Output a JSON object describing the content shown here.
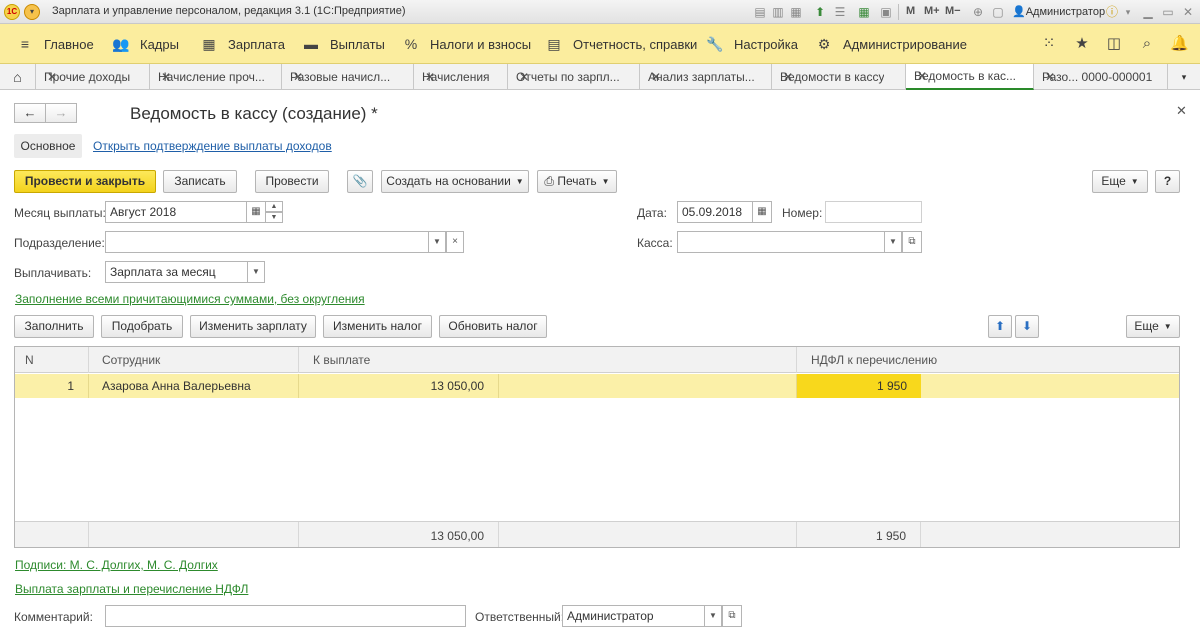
{
  "window": {
    "title": "Зарплата и управление персоналом, редакция 3.1  (1С:Предприятие)",
    "user": "Администратор",
    "toolbar_text": [
      "M",
      "M+",
      "M−"
    ]
  },
  "menu": {
    "items": [
      {
        "label": "Главное",
        "icon": "hamburger-icon"
      },
      {
        "label": "Кадры",
        "icon": "people-icon"
      },
      {
        "label": "Зарплата",
        "icon": "calculator-icon"
      },
      {
        "label": "Выплаты",
        "icon": "wallet-icon"
      },
      {
        "label": "Налоги и взносы",
        "icon": "percent-icon"
      },
      {
        "label": "Отчетность, справки",
        "icon": "documents-icon"
      },
      {
        "label": "Настройка",
        "icon": "wrench-icon"
      },
      {
        "label": "Администрирование",
        "icon": "gear-icon"
      }
    ]
  },
  "tabs": [
    {
      "label": "Прочие доходы"
    },
    {
      "label": "Начисление проч..."
    },
    {
      "label": "Разовые начисл..."
    },
    {
      "label": "Начисления"
    },
    {
      "label": "Отчеты по зарпл..."
    },
    {
      "label": "Анализ зарплаты..."
    },
    {
      "label": "Ведомости в кассу"
    },
    {
      "label": "Ведомость в кас..."
    },
    {
      "label": "Разо... 0000-000001"
    }
  ],
  "form": {
    "title": "Ведомость в кассу (создание) *",
    "section_main": "Основное",
    "link_confirm": "Открыть подтверждение выплаты доходов",
    "buttons": {
      "post_close": "Провести и закрыть",
      "save": "Записать",
      "post": "Провести",
      "create_based": "Создать на основании",
      "print": "Печать",
      "more": "Еще",
      "help": "?"
    },
    "fields": {
      "month_label": "Месяц выплаты:",
      "month_value": "Август 2018",
      "date_label": "Дата:",
      "date_value": "05.09.2018",
      "number_label": "Номер:",
      "number_value": "",
      "division_label": "Подразделение:",
      "division_value": "",
      "cash_label": "Касса:",
      "cash_value": "",
      "pay_label": "Выплачивать:",
      "pay_value": "Зарплата за месяц"
    },
    "fill_link": "Заполнение всеми причитающимися суммами, без округления",
    "table_buttons": {
      "fill": "Заполнить",
      "pick": "Подобрать",
      "change_salary": "Изменить зарплату",
      "change_tax": "Изменить налог",
      "update_tax": "Обновить налог",
      "more": "Еще"
    },
    "table": {
      "headers": {
        "n": "N",
        "employee": "Сотрудник",
        "to_pay": "К выплате",
        "ndfl": "НДФЛ к перечислению"
      },
      "rows": [
        {
          "n": "1",
          "employee": "Азарова Анна Валерьевна",
          "to_pay": "13 050,00",
          "ndfl": "1 950"
        }
      ],
      "totals": {
        "to_pay": "13 050,00",
        "ndfl": "1 950"
      }
    },
    "signatures_link": "Подписи: М. С. Долгих, М. С. Долгих",
    "payment_link": "Выплата зарплаты и перечисление НДФЛ",
    "comment_label": "Комментарий:",
    "comment_value": "",
    "responsible_label": "Ответственный:",
    "responsible_value": "Администратор"
  },
  "colors": {
    "menu_bg": "#fbed9e",
    "primary_button": "#f3d21c",
    "selected_row": "#fbf0a8",
    "selected_cell": "#f8d81c",
    "link_blue": "#1f5fa8",
    "link_green": "#2d8a2d"
  }
}
